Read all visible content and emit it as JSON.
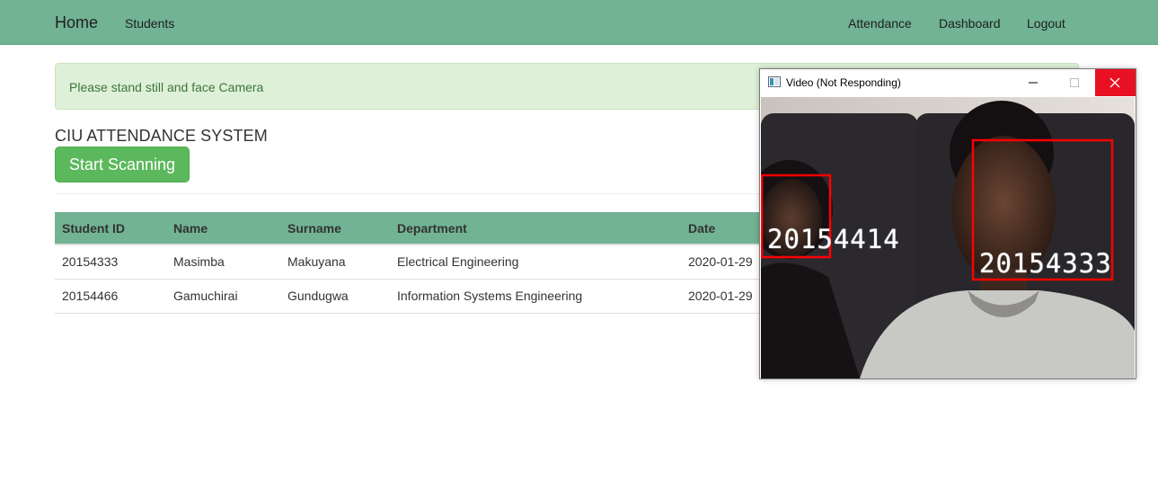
{
  "nav": {
    "brand": "Home",
    "left_links": [
      "Students"
    ],
    "right_links": [
      "Attendance",
      "Dashboard",
      "Logout"
    ],
    "bg_color": "#71b393"
  },
  "alert": {
    "message": "Please stand still and face Camera"
  },
  "page": {
    "title": "CIU ATTENDANCE SYSTEM",
    "scan_button": "Start Scanning"
  },
  "table": {
    "headers": [
      "Student ID",
      "Name",
      "Surname",
      "Department",
      "Date"
    ],
    "rows": [
      [
        "20154333",
        "Masimba",
        "Makuyana",
        "Electrical Engineering",
        "2020-01-29"
      ],
      [
        "20154466",
        "Gamuchirai",
        "Gundugwa",
        "Information Systems Engineering",
        "2020-01-29"
      ]
    ]
  },
  "video_window": {
    "title": "Video (Not Responding)",
    "icons": [
      "app-icon",
      "minimize-icon",
      "maximize-icon",
      "close-icon"
    ],
    "close_color": "#e81123",
    "face_labels": [
      "20154414",
      "20154333"
    ],
    "box_color": "#ff0000"
  }
}
